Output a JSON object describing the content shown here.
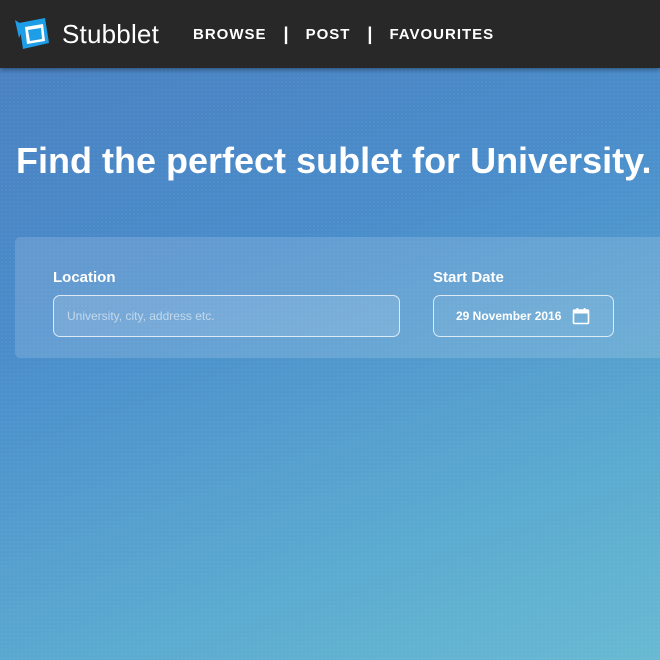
{
  "brand": {
    "name": "Stubblet",
    "logo_icon": "stubblet-logo-icon",
    "accent_color": "#1e9ee6"
  },
  "nav": {
    "items": [
      {
        "label": "BROWSE"
      },
      {
        "label": "POST"
      },
      {
        "label": "FAVOURITES"
      }
    ],
    "separator": "|"
  },
  "hero": {
    "title_part1": "Find the",
    "title_emphasis": "perfect",
    "title_part2": "sublet for University."
  },
  "search": {
    "location_label": "Location",
    "location_placeholder": "University, city, address etc.",
    "location_value": "",
    "start_date_label": "Start Date",
    "start_date_value": "29 November 2016",
    "calendar_icon": "calendar-icon"
  },
  "colors": {
    "navbar_background": "#282828",
    "gradient_start": "#4a7fc0",
    "gradient_end": "#68b9d2"
  }
}
